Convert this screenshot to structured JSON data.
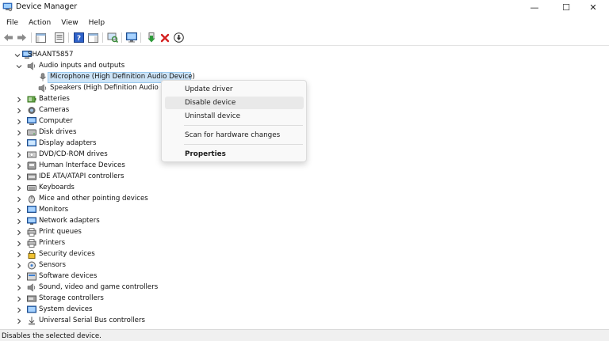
{
  "window": {
    "title": "Device Manager",
    "minimize_glyph": "—",
    "maximize_glyph": "☐",
    "close_glyph": "✕"
  },
  "menu": {
    "items": [
      "File",
      "Action",
      "View",
      "Help"
    ]
  },
  "toolbar": {
    "buttons": [
      "back-arrow-icon",
      "forward-arrow-icon",
      "show-hide-console-tree-icon",
      "properties-icon",
      "help-icon",
      "action-pane-icon",
      "scan-hardware-icon",
      "computer-monitor-icon",
      "update-driver-icon",
      "uninstall-device-icon",
      "disable-device-icon"
    ]
  },
  "tree": {
    "root": "SHAANT5857",
    "expanded_category": "Audio inputs and outputs",
    "audio_children": [
      "Microphone (High Definition Audio Device)",
      "Speakers (High Definition Audio De"
    ],
    "categories": [
      "Batteries",
      "Cameras",
      "Computer",
      "Disk drives",
      "Display adapters",
      "DVD/CD-ROM drives",
      "Human Interface Devices",
      "IDE ATA/ATAPI controllers",
      "Keyboards",
      "Mice and other pointing devices",
      "Monitors",
      "Network adapters",
      "Print queues",
      "Printers",
      "Security devices",
      "Sensors",
      "Software devices",
      "Sound, video and game controllers",
      "Storage controllers",
      "System devices",
      "Universal Serial Bus controllers"
    ]
  },
  "context_menu": {
    "update_driver": "Update driver",
    "disable_device": "Disable device",
    "uninstall_device": "Uninstall device",
    "scan_hardware": "Scan for hardware changes",
    "properties": "Properties"
  },
  "status": {
    "text": "Disables the selected device."
  },
  "colors": {
    "selection": "#cde4f7",
    "selection_border": "#99c9ef",
    "menu_hover": "#e9e9e9"
  }
}
